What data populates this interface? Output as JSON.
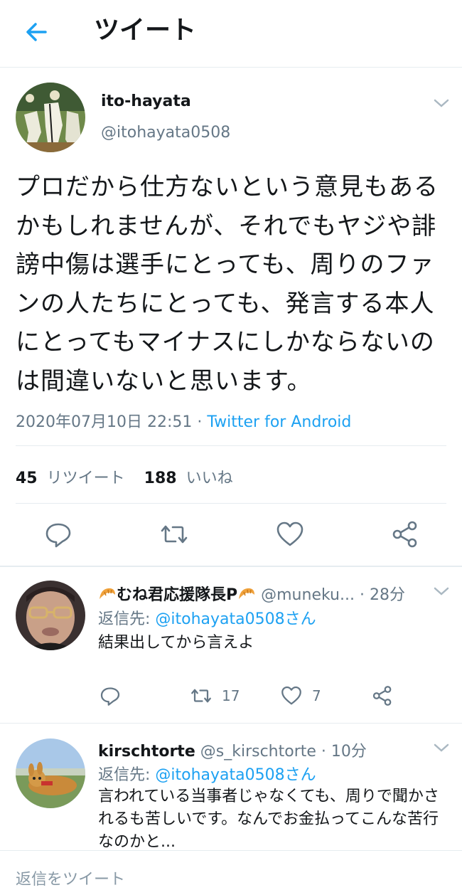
{
  "header": {
    "title": "ツイート"
  },
  "tweet": {
    "author_name": "ito-hayata",
    "handle": "@itohayata0508",
    "text": "プロだから仕方ないという意見もあるかもしれませんが、それでもヤジや誹謗中傷は選手にとっても、周りのファンの人たちにとっても、発言する本人にとってもマイナスにしかならないのは間違いないと思います。",
    "timestamp": "2020年07月10日 22:51",
    "separator": " · ",
    "source": "Twitter for Android",
    "retweet_count": "45",
    "retweet_label": "リツイート",
    "like_count": "188",
    "like_label": "いいね"
  },
  "replies": [
    {
      "name": "むね君応援隊長P",
      "handle_time": "@muneku... · 28分",
      "reply_prefix": "返信先: ",
      "reply_to": "@itohayata0508さん",
      "text": "結果出してから言えよ",
      "retweets": "17",
      "likes": "7"
    },
    {
      "name": "kirschtorte",
      "handle_time": "@s_kirschtorte · 10分",
      "reply_prefix": "返信先: ",
      "reply_to": "@itohayata0508さん",
      "text": "言われている当事者じゃなくても、周りで聞かされるも苦しいです。なんでお金払ってこんな苦行なのかと..."
    }
  ],
  "compose": {
    "placeholder": "返信をツイート"
  },
  "colors": {
    "accent": "#1da1f2",
    "secondary_text": "#657786",
    "divider": "#e6ecf0"
  }
}
